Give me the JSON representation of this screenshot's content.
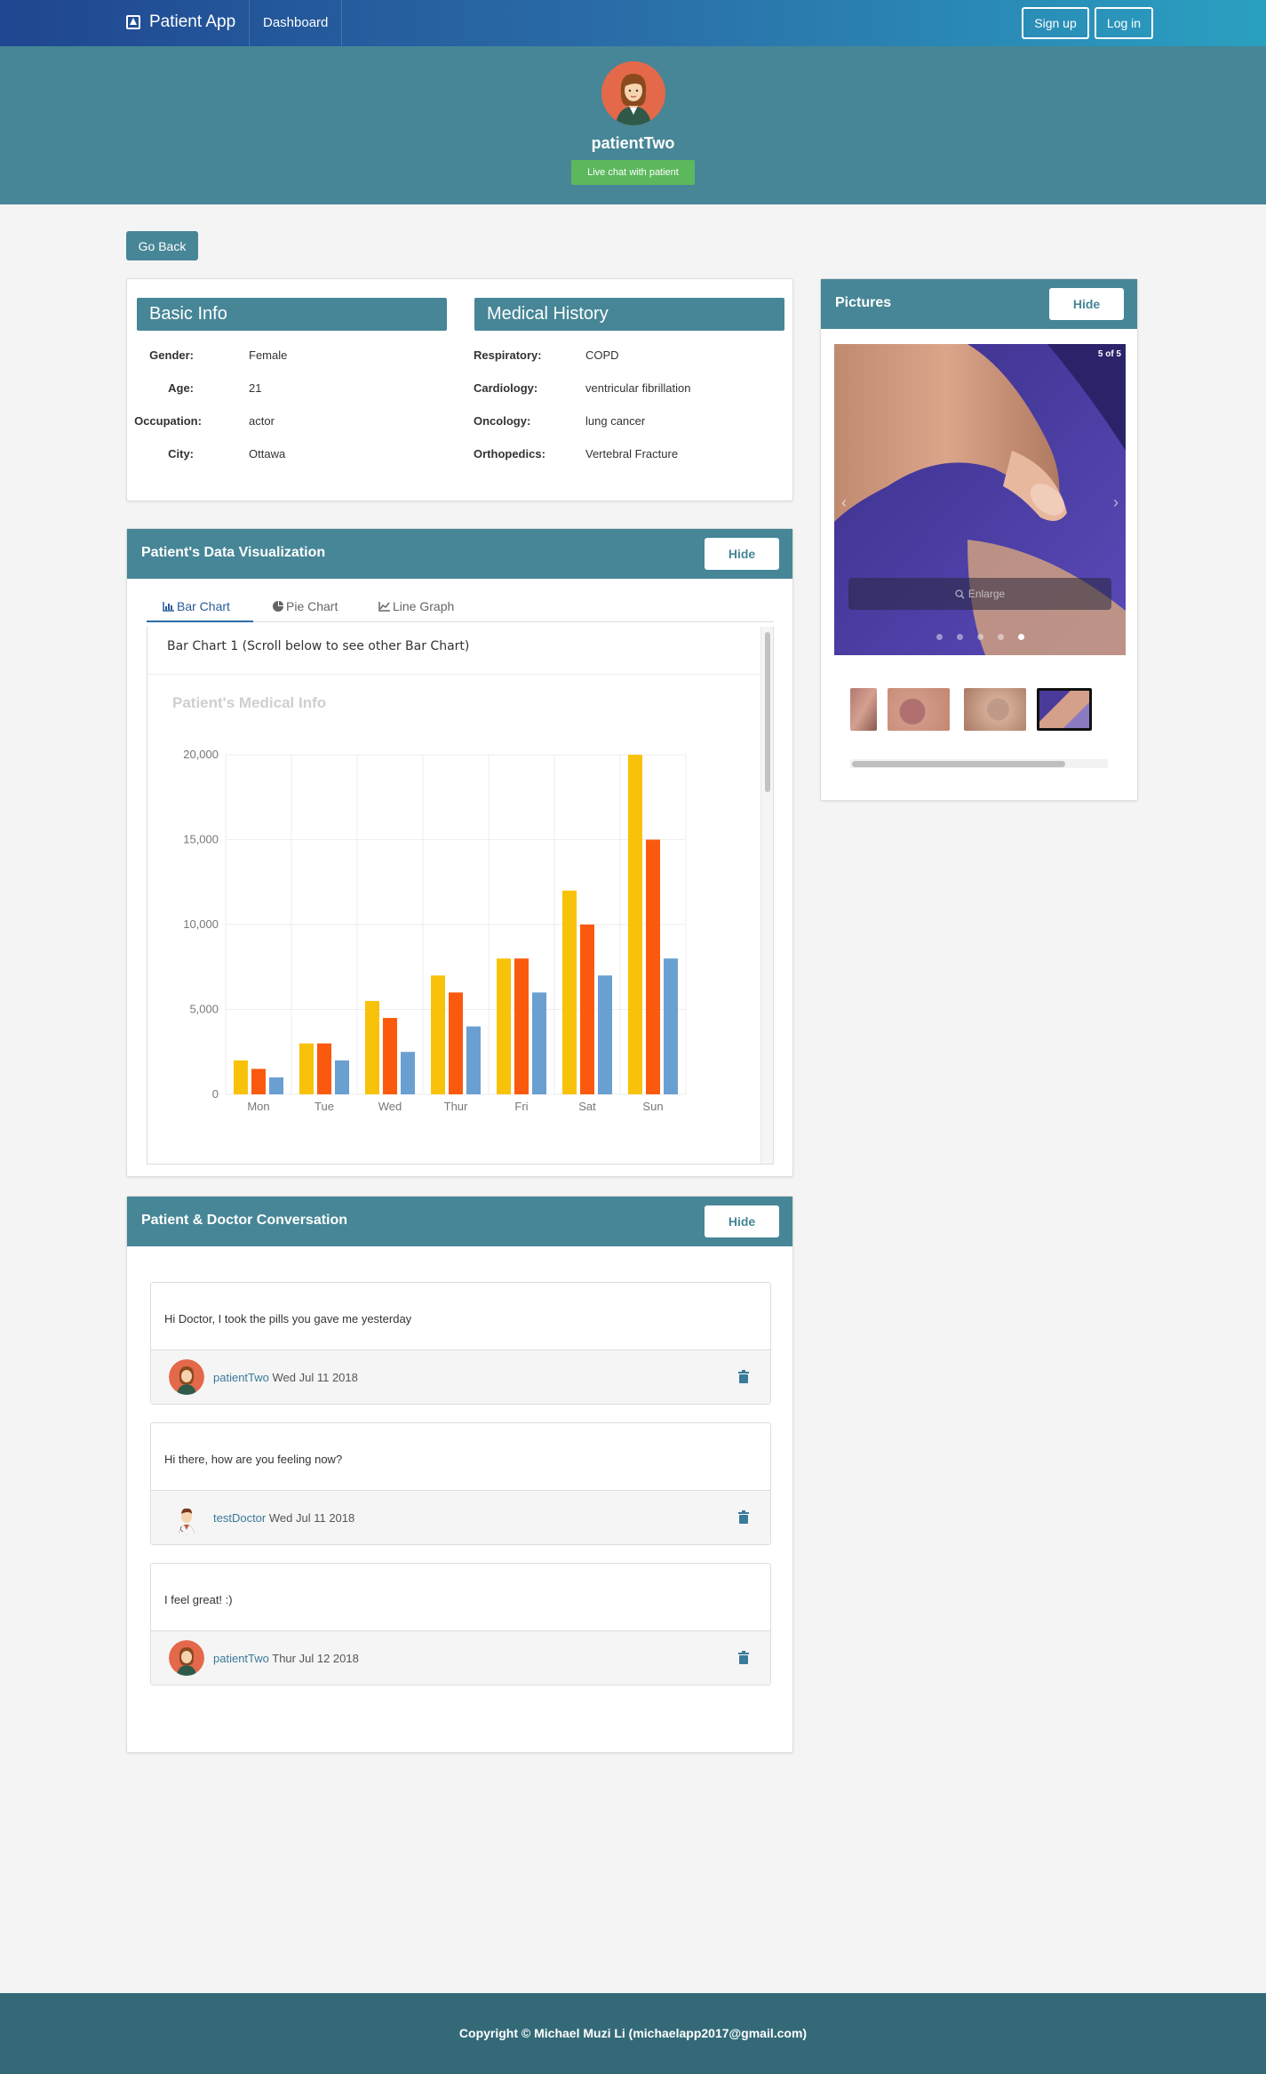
{
  "navbar": {
    "brand": "Patient App",
    "dashboard": "Dashboard",
    "signup": "Sign up",
    "login": "Log in"
  },
  "profile": {
    "name": "patientTwo",
    "live_chat": "Live chat with patient"
  },
  "go_back": "Go Back",
  "basic_info": {
    "title": "Basic Info",
    "rows": [
      {
        "label": "Gender:",
        "value": "Female"
      },
      {
        "label": "Age:",
        "value": "21"
      },
      {
        "label": "Occupation:",
        "value": "actor"
      },
      {
        "label": "City:",
        "value": "Ottawa"
      }
    ]
  },
  "medical_history": {
    "title": "Medical History",
    "rows": [
      {
        "label": "Respiratory:",
        "value": "COPD"
      },
      {
        "label": "Cardiology:",
        "value": "ventricular fibrillation"
      },
      {
        "label": "Oncology:",
        "value": "lung cancer"
      },
      {
        "label": "Orthopedics:",
        "value": "Vertebral Fracture"
      }
    ]
  },
  "visualization": {
    "title": "Patient's Data Visualization",
    "hide": "Hide",
    "tabs": [
      "Bar Chart",
      "Pie Chart",
      "Line Graph"
    ],
    "caption": "Bar Chart 1 (Scroll below to see other Bar Chart)"
  },
  "chart_data": {
    "type": "bar",
    "title": "Patient's Medical Info",
    "categories": [
      "Mon",
      "Tue",
      "Wed",
      "Thur",
      "Fri",
      "Sat",
      "Sun"
    ],
    "series": [
      {
        "color": "#f9c20a",
        "values": [
          2000,
          3000,
          5500,
          7000,
          8000,
          12000,
          20000
        ]
      },
      {
        "color": "#fb5a0e",
        "values": [
          1500,
          3000,
          4500,
          6000,
          8000,
          10000,
          15000
        ]
      },
      {
        "color": "#6a9fd2",
        "values": [
          1000,
          2000,
          2500,
          4000,
          6000,
          7000,
          8000
        ]
      }
    ],
    "yticks": [
      "0",
      "5,000",
      "10,000",
      "15,000",
      "20,000"
    ],
    "ylim": [
      0,
      20000
    ],
    "grid": true,
    "xlabel": "",
    "ylabel": ""
  },
  "pictures": {
    "title": "Pictures",
    "hide": "Hide",
    "counter": "5 of 5",
    "enlarge": "Enlarge",
    "total": 5,
    "active_index": 4
  },
  "conversation": {
    "title": "Patient & Doctor Conversation",
    "hide": "Hide",
    "messages": [
      {
        "text": "Hi Doctor, I took the pills you gave me yesterday",
        "author": "patientTwo",
        "date": "Wed Jul 11 2018"
      },
      {
        "text": "Hi there, how are you feeling now?",
        "author": "testDoctor",
        "date": "Wed Jul 11 2018"
      },
      {
        "text": "I feel great! :)",
        "author": "patientTwo",
        "date": "Thur Jul 12 2018"
      }
    ]
  },
  "footer": "Copyright © Michael Muzi Li (michaelapp2017@gmail.com)",
  "colors": {
    "primary": "#468696",
    "success": "#5cb85c",
    "footer": "#346a78",
    "link": "#3a7a9a"
  }
}
